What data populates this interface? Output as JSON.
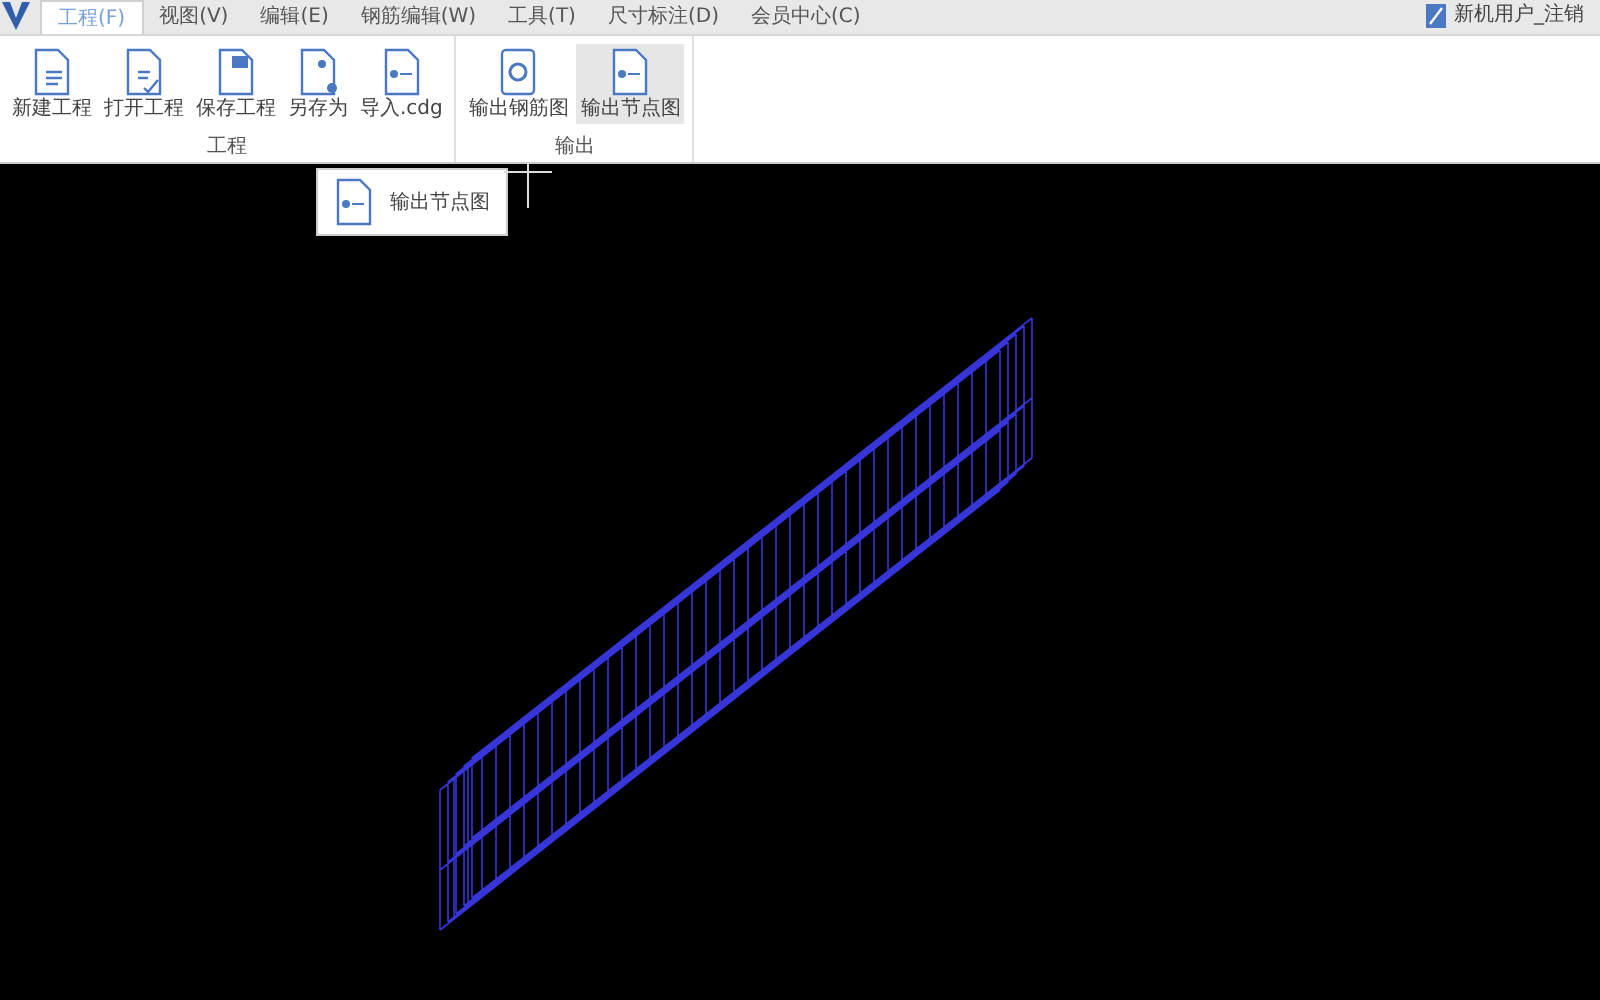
{
  "menu_tabs": [
    {
      "label": "工程(F)",
      "selected": true
    },
    {
      "label": "视图(V)",
      "selected": false
    },
    {
      "label": "编辑(E)",
      "selected": false
    },
    {
      "label": "钢筋编辑(W)",
      "selected": false
    },
    {
      "label": "工具(T)",
      "selected": false
    },
    {
      "label": "尺寸标注(D)",
      "selected": false
    },
    {
      "label": "会员中心(C)",
      "selected": false
    }
  ],
  "user": {
    "label": "新机用户_注销"
  },
  "ribbon_groups": [
    {
      "title": "工程",
      "buttons": [
        {
          "label": "新建工程",
          "highlighted": false
        },
        {
          "label": "打开工程",
          "highlighted": false
        },
        {
          "label": "保存工程",
          "highlighted": false
        },
        {
          "label": "另存为",
          "highlighted": false
        },
        {
          "label": "导入.cdg",
          "highlighted": false
        }
      ]
    },
    {
      "title": "输出",
      "buttons": [
        {
          "label": "输出钢筋图",
          "highlighted": false
        },
        {
          "label": "输出节点图",
          "highlighted": true
        }
      ]
    }
  ],
  "tooltip": {
    "label": "输出节点图"
  }
}
